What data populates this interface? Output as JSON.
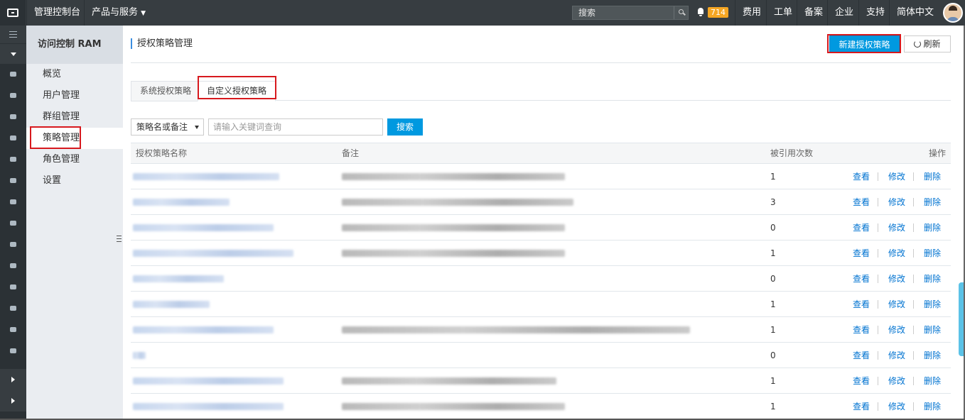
{
  "topbar": {
    "console": "管理控制台",
    "products": "产品与服务",
    "search_placeholder": "搜索",
    "notification_count": "714",
    "links": [
      "费用",
      "工单",
      "备案",
      "企业",
      "支持",
      "简体中文"
    ]
  },
  "subnav": {
    "title": "访问控制 RAM",
    "items": [
      "概览",
      "用户管理",
      "群组管理",
      "策略管理",
      "角色管理",
      "设置"
    ]
  },
  "page": {
    "title": "授权策略管理",
    "new_button": "新建授权策略",
    "refresh_button": "刷新"
  },
  "tabs": [
    "系统授权策略",
    "自定义授权策略"
  ],
  "filter": {
    "select_value": "策略名或备注",
    "input_placeholder": "请输入关键词查询",
    "search_button": "搜索"
  },
  "table": {
    "columns": [
      "授权策略名称",
      "备注",
      "被引用次数",
      "操作"
    ],
    "actions": [
      "查看",
      "修改",
      "删除"
    ],
    "rows": [
      {
        "count": "1"
      },
      {
        "count": "3"
      },
      {
        "count": "0"
      },
      {
        "count": "1"
      },
      {
        "count": "0"
      },
      {
        "count": "1"
      },
      {
        "count": "1"
      },
      {
        "count": "0"
      },
      {
        "count": "1"
      },
      {
        "count": "1"
      }
    ]
  }
}
